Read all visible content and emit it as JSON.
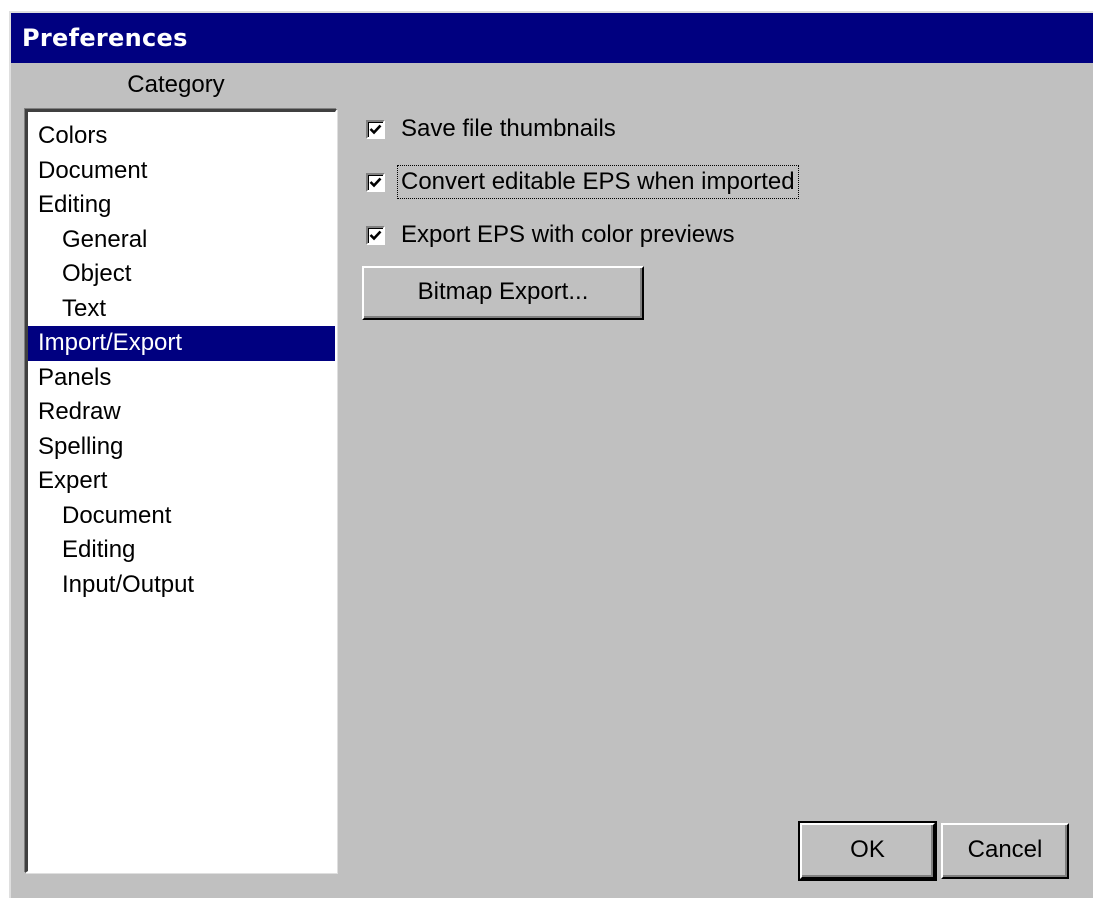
{
  "window": {
    "title": "Preferences"
  },
  "category": {
    "label": "Category",
    "items": [
      {
        "label": "Colors"
      },
      {
        "label": "Document"
      },
      {
        "label": "Editing"
      },
      {
        "label": "General"
      },
      {
        "label": "Object"
      },
      {
        "label": "Text"
      },
      {
        "label": "Import/Export"
      },
      {
        "label": "Panels"
      },
      {
        "label": "Redraw"
      },
      {
        "label": "Spelling"
      },
      {
        "label": "Expert"
      },
      {
        "label": "Document"
      },
      {
        "label": "Editing"
      },
      {
        "label": "Input/Output"
      }
    ],
    "selected": "Import/Export"
  },
  "options": {
    "save_thumbnails": {
      "label": "Save file thumbnails",
      "checked": true
    },
    "convert_eps": {
      "label": "Convert editable EPS when imported",
      "checked": true
    },
    "export_eps_previews": {
      "label": "Export EPS with color previews",
      "checked": true
    }
  },
  "buttons": {
    "bitmap_export": "Bitmap Export...",
    "ok": "OK",
    "cancel": "Cancel"
  },
  "colors": {
    "titlebar": "#000080",
    "selection": "#000080",
    "dialog_bg": "#c0c0c0"
  }
}
